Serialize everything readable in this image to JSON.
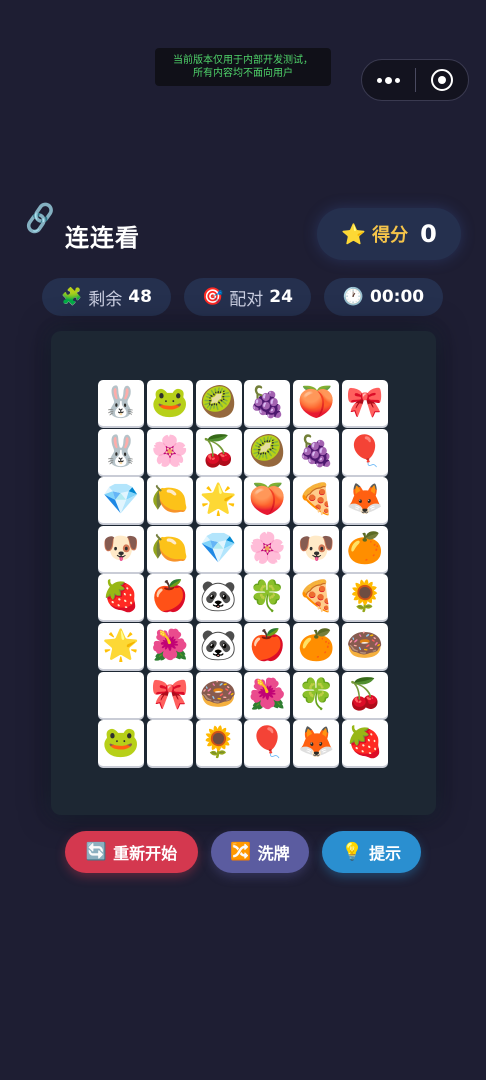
{
  "notice": {
    "line1": "当前版本仅用于内部开发测试，",
    "line2": "所有内容均不面向用户"
  },
  "header": {
    "icon": "🔗",
    "title": "连连看",
    "score_icon": "⭐",
    "score_label": "得分",
    "score_value": "0"
  },
  "stats": {
    "remaining_icon": "🧩",
    "remaining_label": "剩余",
    "remaining_value": "48",
    "pairs_icon": "🎯",
    "pairs_label": "配对",
    "pairs_value": "24",
    "timer_icon": "🕐",
    "timer_value": "00:00"
  },
  "board": {
    "rows": [
      [
        "🐰",
        "🐸",
        "🥝",
        "🍇",
        "🍑",
        "🎀"
      ],
      [
        "🐰",
        "🌸",
        "🍒",
        "🥝",
        "🍇",
        "🎈"
      ],
      [
        "💎",
        "🍋",
        "🌟",
        "🍑",
        "🍕",
        "🦊"
      ],
      [
        "🐶",
        "🍋",
        "💎",
        "🌸",
        "🐶",
        "🍊"
      ],
      [
        "🍓",
        "🍎",
        "🐼",
        "🍀",
        "🍕",
        "🌻"
      ],
      [
        "🌟",
        "🌺",
        "🐼",
        "🍎",
        "🍊",
        "🍩"
      ],
      [
        "🐱",
        "🎀",
        "🍩",
        "🌺",
        "🍀",
        "🍒"
      ],
      [
        "🐸",
        "🐱",
        "🌻",
        "🎈",
        "🦊",
        "🍓"
      ]
    ]
  },
  "buttons": {
    "restart_icon": "🔄",
    "restart_label": "重新开始",
    "shuffle_icon": "🔀",
    "shuffle_label": "洗牌",
    "hint_icon": "💡",
    "hint_label": "提示"
  }
}
